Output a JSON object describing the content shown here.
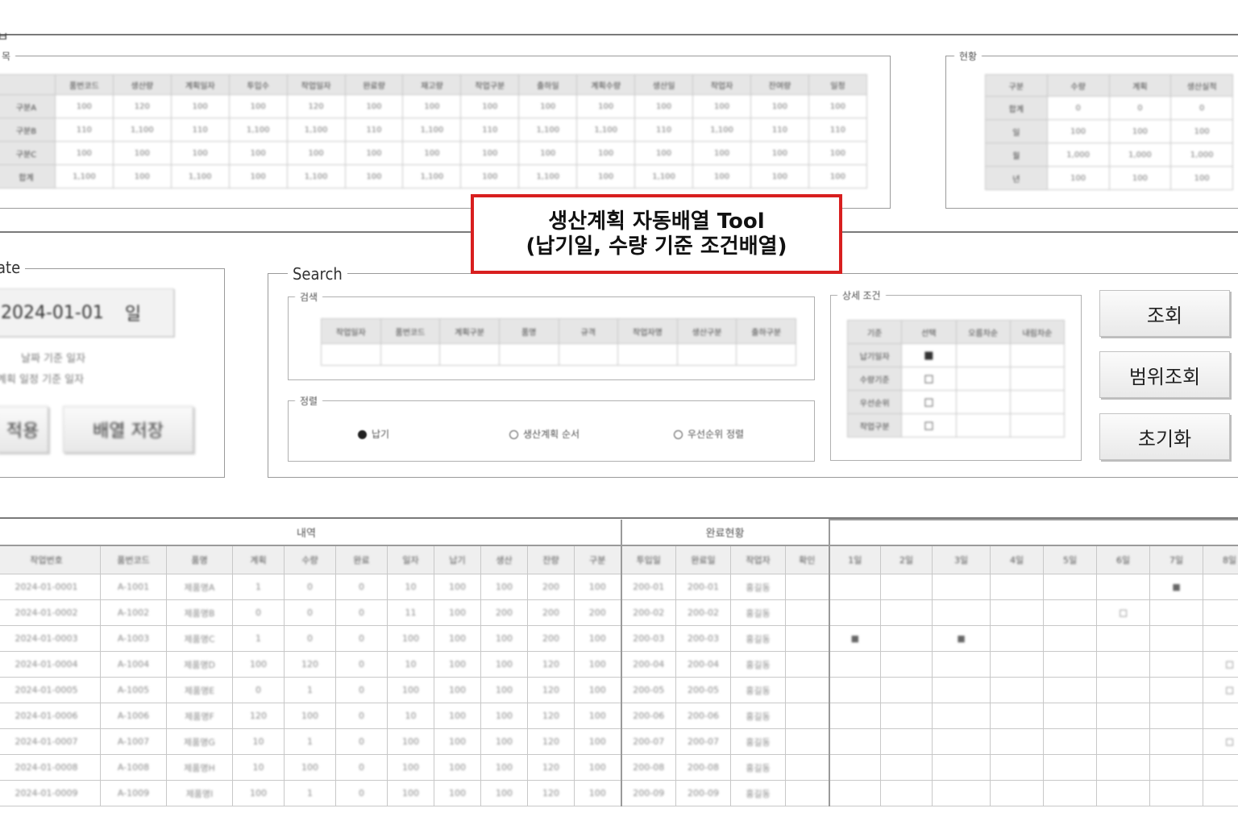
{
  "top_panel": {
    "left_fragment": "ㅂ",
    "table_fragment": "목",
    "table": {
      "headers": [
        "품번코드",
        "생산량",
        "계획일자",
        "투입수",
        "작업일자",
        "완료량",
        "재고량",
        "작업구분",
        "출하일",
        "계획수량",
        "생산일",
        "작업자",
        "잔여량",
        "일정"
      ],
      "rows": [
        [
          "구분A",
          "100",
          "120",
          "100",
          "100",
          "120",
          "100",
          "100",
          "100",
          "100",
          "100",
          "100",
          "100",
          "100",
          "100"
        ],
        [
          "구분B",
          "110",
          "1,100",
          "110",
          "1,100",
          "1,100",
          "110",
          "1,100",
          "110",
          "1,100",
          "1,100",
          "110",
          "1,100",
          "110",
          "110"
        ],
        [
          "구분C",
          "100",
          "100",
          "100",
          "100",
          "100",
          "100",
          "100",
          "100",
          "100",
          "100",
          "100",
          "100",
          "100",
          "100"
        ],
        [
          "합계",
          "1,100",
          "100",
          "1,100",
          "100",
          "1,100",
          "100",
          "1,100",
          "100",
          "1,100",
          "100",
          "1,100",
          "100",
          "100",
          "100"
        ]
      ]
    }
  },
  "right_panel": {
    "legend": "현황",
    "table": {
      "headers": [
        "구분",
        "수량",
        "계획",
        "생산실적"
      ],
      "rows": [
        [
          "합계",
          "0",
          "0",
          "0"
        ],
        [
          "일",
          "100",
          "100",
          "100"
        ],
        [
          "월",
          "1,000",
          "1,000",
          "1,000"
        ],
        [
          "년",
          "100",
          "100",
          "100"
        ]
      ]
    }
  },
  "callout": {
    "line1": "생산계획 자동배열 Tool",
    "line2": "(납기일, 수량 기준 조건배열)"
  },
  "date_panel": {
    "legend_fragment": "ate",
    "date_value": "2024-01-01",
    "date_suffix": "일",
    "note_line1": "날짜 기준 일자",
    "note_line2": "계획 일정 기준 일자",
    "btn_left": "적용",
    "btn_right": "배열 저장"
  },
  "search_panel": {
    "legend": "Search",
    "filter": {
      "legend": "검색",
      "headers": [
        "작업일자",
        "품번코드",
        "계획구분",
        "품명",
        "규격",
        "작업자명",
        "생산구분",
        "출하구분"
      ]
    },
    "sort_options": {
      "legend": "정렬",
      "options": [
        {
          "label": "납기",
          "selected": true
        },
        {
          "label": "생산계획 순서",
          "selected": false
        },
        {
          "label": "우선순위 정렬",
          "selected": false
        }
      ]
    },
    "sort_condition": {
      "legend": "상세 조건",
      "headers": [
        "기준",
        "선택",
        "오름차순",
        "내림차순"
      ],
      "rows": [
        {
          "label": "납기일자",
          "mark": "■"
        },
        {
          "label": "수량기준",
          "mark": "□"
        },
        {
          "label": "우선순위",
          "mark": "□"
        },
        {
          "label": "작업구분",
          "mark": "□"
        }
      ]
    }
  },
  "buttons": {
    "query": "조회",
    "range_query": "범위조회",
    "reset": "초기화"
  },
  "bottom_panel": {
    "group_left": "내역",
    "group_mid": "완료현황",
    "headers": [
      "작업번호",
      "품번코드",
      "품명",
      "계획",
      "수량",
      "완료",
      "일자",
      "납기",
      "생산",
      "잔량",
      "구분",
      "투입일",
      "완료일",
      "작업자",
      "확인",
      "1일",
      "2일",
      "3일",
      "4일",
      "5일",
      "6일",
      "7일",
      "8일"
    ],
    "rows": [
      [
        "2024-01-0001",
        "A-1001",
        "제품명A",
        "1",
        "0",
        "0",
        "10",
        "100",
        "100",
        "200",
        "100",
        "200-01",
        "200-01",
        "홍길동",
        "",
        "",
        "",
        "",
        "",
        "",
        "",
        "■",
        ""
      ],
      [
        "2024-01-0002",
        "A-1002",
        "제품명B",
        "0",
        "0",
        "0",
        "11",
        "100",
        "200",
        "200",
        "200",
        "200-02",
        "200-02",
        "홍길동",
        "",
        "",
        "",
        "",
        "",
        "",
        "□",
        "",
        ""
      ],
      [
        "2024-01-0003",
        "A-1003",
        "제품명C",
        "1",
        "0",
        "0",
        "100",
        "100",
        "100",
        "200",
        "100",
        "200-03",
        "200-03",
        "홍길동",
        "",
        "■",
        "",
        "■",
        "",
        "",
        "",
        "",
        ""
      ],
      [
        "2024-01-0004",
        "A-1004",
        "제품명D",
        "100",
        "120",
        "0",
        "10",
        "100",
        "100",
        "120",
        "100",
        "200-04",
        "200-04",
        "홍길동",
        "",
        "",
        "",
        "",
        "",
        "",
        "",
        "",
        "□"
      ],
      [
        "2024-01-0005",
        "A-1005",
        "제품명E",
        "0",
        "1",
        "0",
        "100",
        "100",
        "100",
        "120",
        "100",
        "200-05",
        "200-05",
        "홍길동",
        "",
        "",
        "",
        "",
        "",
        "",
        "",
        "",
        "□"
      ],
      [
        "2024-01-0006",
        "A-1006",
        "제품명F",
        "120",
        "100",
        "0",
        "10",
        "100",
        "100",
        "120",
        "100",
        "200-06",
        "200-06",
        "홍길동",
        "",
        "",
        "",
        "",
        "",
        "",
        "",
        "",
        ""
      ],
      [
        "2024-01-0007",
        "A-1007",
        "제품명G",
        "10",
        "1",
        "0",
        "100",
        "100",
        "100",
        "120",
        "100",
        "200-07",
        "200-07",
        "홍길동",
        "",
        "",
        "",
        "",
        "",
        "",
        "",
        "",
        "□"
      ],
      [
        "2024-01-0008",
        "A-1008",
        "제품명H",
        "10",
        "100",
        "0",
        "100",
        "100",
        "100",
        "120",
        "100",
        "200-08",
        "200-08",
        "홍길동",
        "",
        "",
        "",
        "",
        "",
        "",
        "",
        "",
        ""
      ],
      [
        "2024-01-0009",
        "A-1009",
        "제품명I",
        "100",
        "1",
        "0",
        "100",
        "100",
        "100",
        "120",
        "100",
        "200-09",
        "200-09",
        "홍길동",
        "",
        "",
        "",
        "",
        "",
        "",
        "",
        "",
        ""
      ]
    ]
  },
  "colors": {
    "callout_border": "#d81f1f",
    "frame": "#9a9a9a",
    "header_bg": "#e6e6e6"
  }
}
